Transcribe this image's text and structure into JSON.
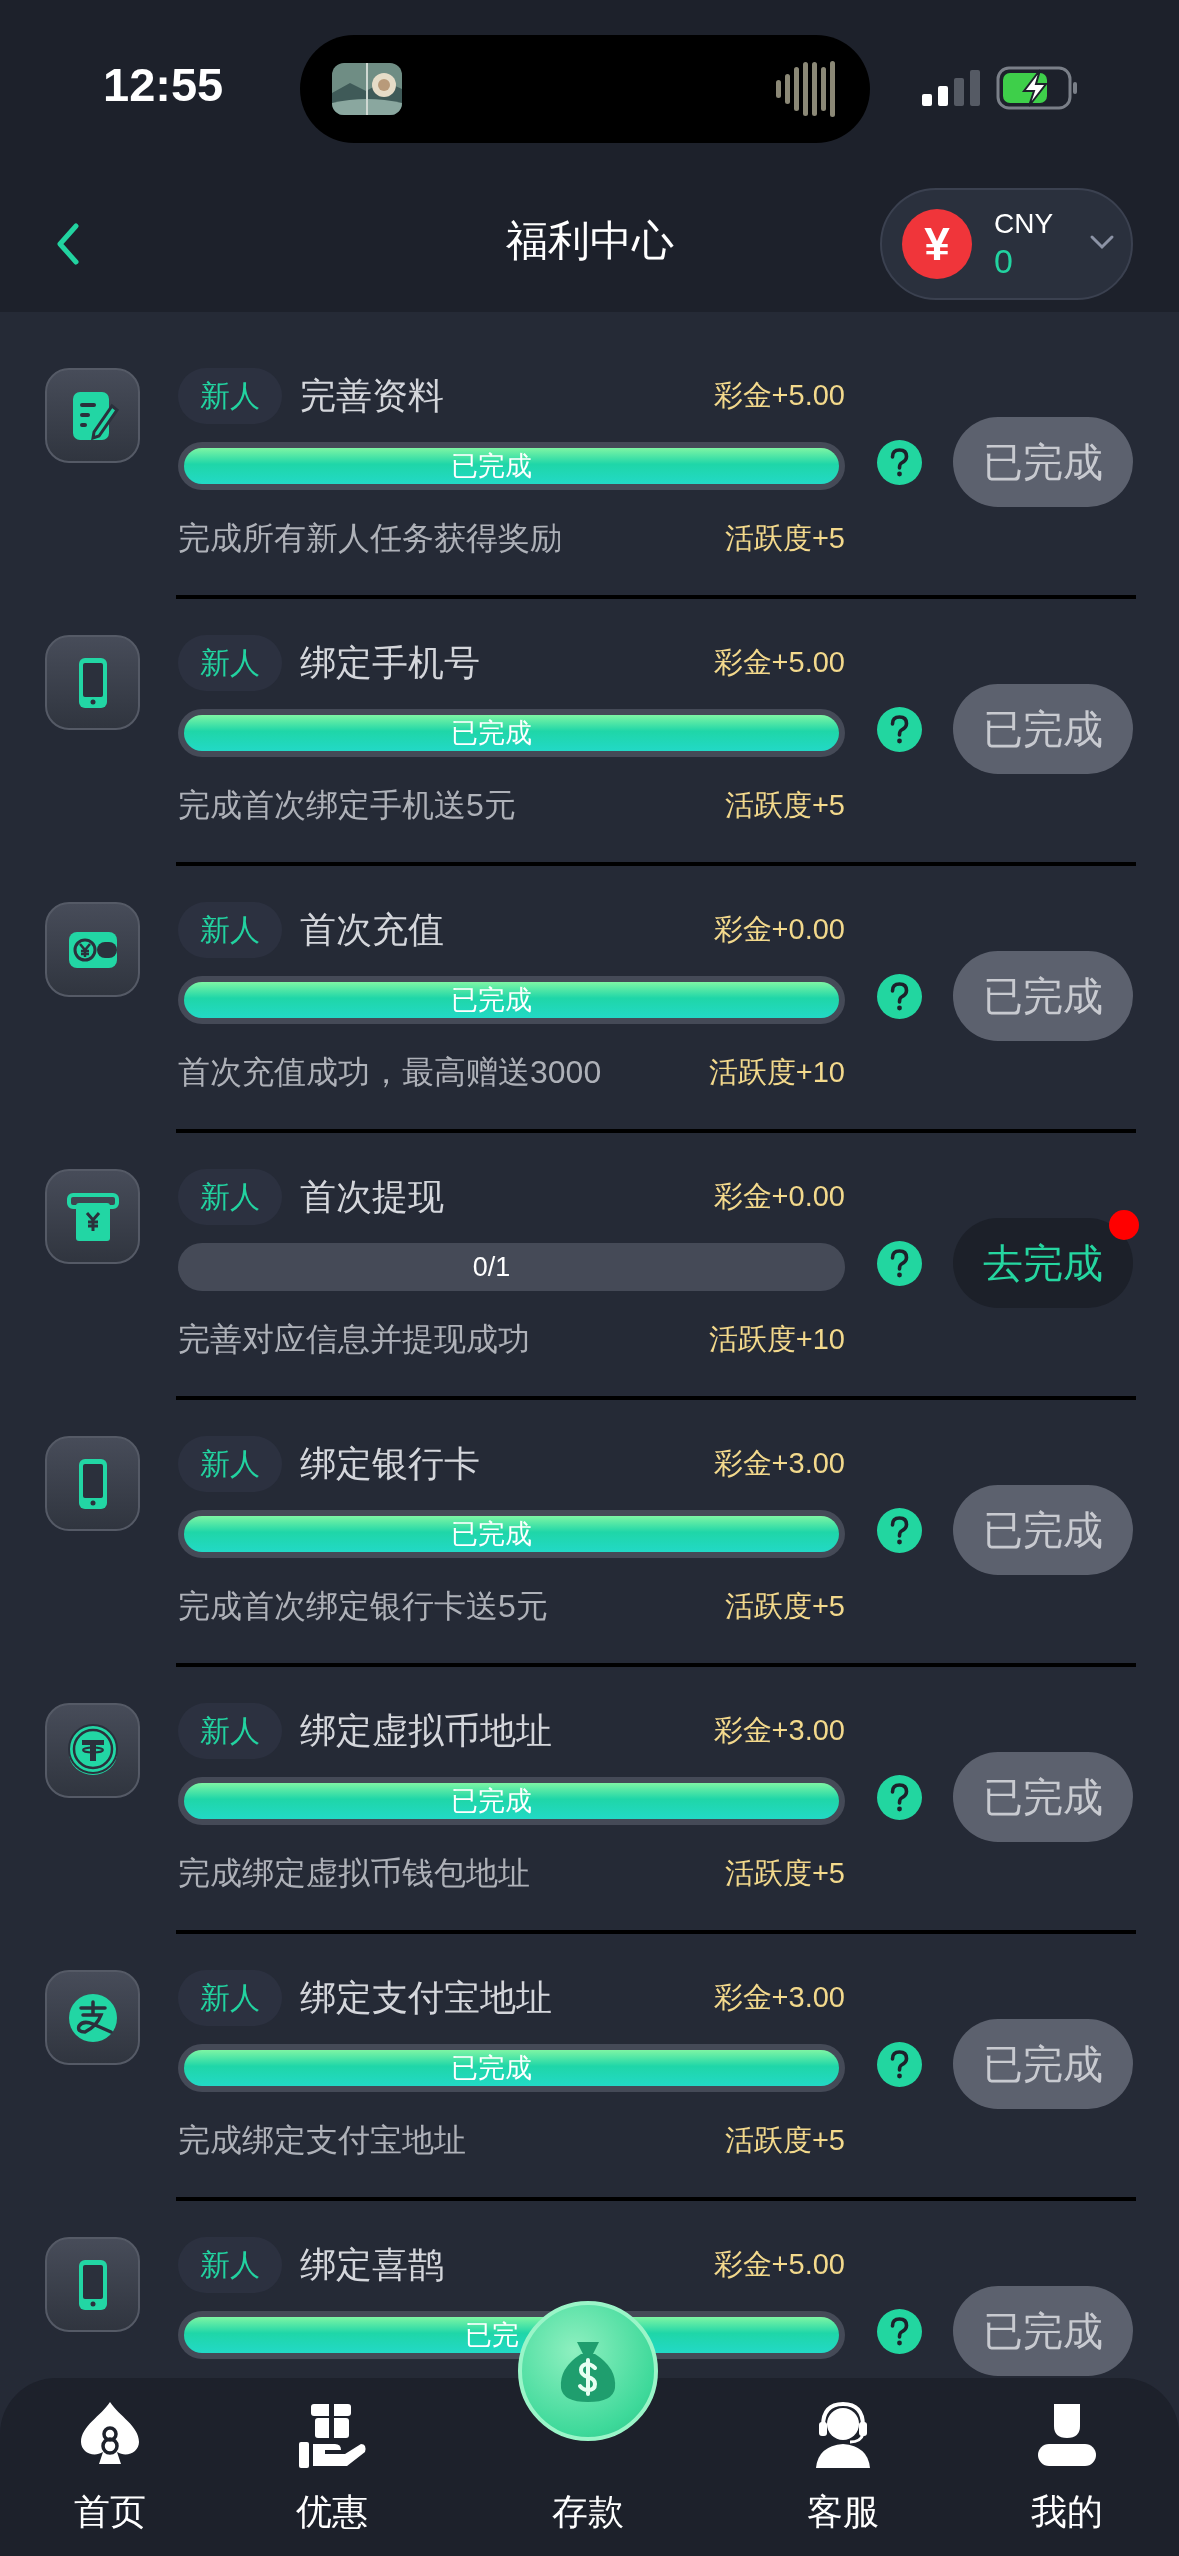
{
  "status_bar": {
    "time": "12:55"
  },
  "header": {
    "title": "福利中心",
    "currency": {
      "symbol": "¥",
      "code": "CNY",
      "balance": "0"
    }
  },
  "tasks": [
    {
      "kind": "form",
      "tag": "新人",
      "title": "完善资料",
      "reward": "彩金+5.00",
      "level": 1,
      "progress_label": "已完成",
      "description": "完成所有新人任务获得奖励",
      "activity": "活跃度+5",
      "button": {
        "label": "已完成",
        "done": true,
        "notify": false
      }
    },
    {
      "kind": "phone",
      "tag": "新人",
      "title": "绑定手机号",
      "reward": "彩金+5.00",
      "level": 1,
      "progress_label": "已完成",
      "description": "完成首次绑定手机送5元",
      "activity": "活跃度+5",
      "button": {
        "label": "已完成",
        "done": true,
        "notify": false
      }
    },
    {
      "kind": "wallet",
      "tag": "新人",
      "title": "首次充值",
      "reward": "彩金+0.00",
      "level": 1,
      "progress_label": "已完成",
      "description": "首次充值成功，最高赠送3000",
      "activity": "活跃度+10",
      "button": {
        "label": "已完成",
        "done": true,
        "notify": false
      }
    },
    {
      "kind": "atm",
      "tag": "新人",
      "title": "首次提现",
      "reward": "彩金+0.00",
      "level": 0,
      "progress_label": "0/1",
      "description": "完善对应信息并提现成功",
      "activity": "活跃度+10",
      "button": {
        "label": "去完成",
        "done": false,
        "notify": true
      }
    },
    {
      "kind": "phone",
      "tag": "新人",
      "title": "绑定银行卡",
      "reward": "彩金+3.00",
      "level": 1,
      "progress_label": "已完成",
      "description": "完成首次绑定银行卡送5元",
      "activity": "活跃度+5",
      "button": {
        "label": "已完成",
        "done": true,
        "notify": false
      }
    },
    {
      "kind": "coin",
      "tag": "新人",
      "title": "绑定虚拟币地址",
      "reward": "彩金+3.00",
      "level": 1,
      "progress_label": "已完成",
      "description": "完成绑定虚拟币钱包地址",
      "activity": "活跃度+5",
      "button": {
        "label": "已完成",
        "done": true,
        "notify": false
      }
    },
    {
      "kind": "pay",
      "tag": "新人",
      "title": "绑定支付宝地址",
      "reward": "彩金+3.00",
      "level": 1,
      "progress_label": "已完成",
      "description": "完成绑定支付宝地址",
      "activity": "活跃度+5",
      "button": {
        "label": "已完成",
        "done": true,
        "notify": false
      }
    },
    {
      "kind": "phone",
      "tag": "新人",
      "title": "绑定喜鹊",
      "reward": "彩金+5.00",
      "level": 1,
      "progress_label": "已完",
      "button": {
        "label": "已完成",
        "done": true,
        "notify": false
      }
    }
  ],
  "tab_bar": {
    "items": [
      {
        "kind": "spade",
        "label": "首页"
      },
      {
        "kind": "gift",
        "label": "优惠"
      },
      {
        "kind": "deposit",
        "label": "存款"
      },
      {
        "kind": "support",
        "label": "客服"
      },
      {
        "kind": "profile",
        "label": "我的"
      }
    ]
  }
}
